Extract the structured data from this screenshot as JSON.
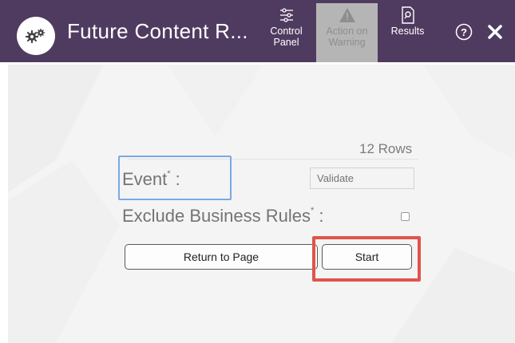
{
  "app": {
    "title": "Future Content R...",
    "icon": "gears-icon"
  },
  "tabs": [
    {
      "label": "Control Panel",
      "icon": "sliders-icon",
      "state": "active"
    },
    {
      "label": "Action on Warning",
      "icon": "warning-triangle-icon",
      "state": "disabled"
    },
    {
      "label": "Results",
      "icon": "document-search-icon",
      "state": "active"
    }
  ],
  "header_buttons": {
    "help": "help-circle-icon",
    "close": "close-icon"
  },
  "form": {
    "rows_count": "12 Rows",
    "event_label": "Event",
    "event_value_placeholder": "Validate",
    "exclude_label": "Exclude Business Rules",
    "required_marker": "*",
    "label_suffix": " :",
    "exclude_checked": false
  },
  "actions": {
    "return_label": "Return to Page",
    "start_label": "Start"
  },
  "colors": {
    "header_bg": "#503b60",
    "content_bg": "#f4f4f4",
    "focus_border": "#7aa8e6",
    "annotation_red": "#e0544b",
    "disabled_tab": "#b5b5b5"
  }
}
